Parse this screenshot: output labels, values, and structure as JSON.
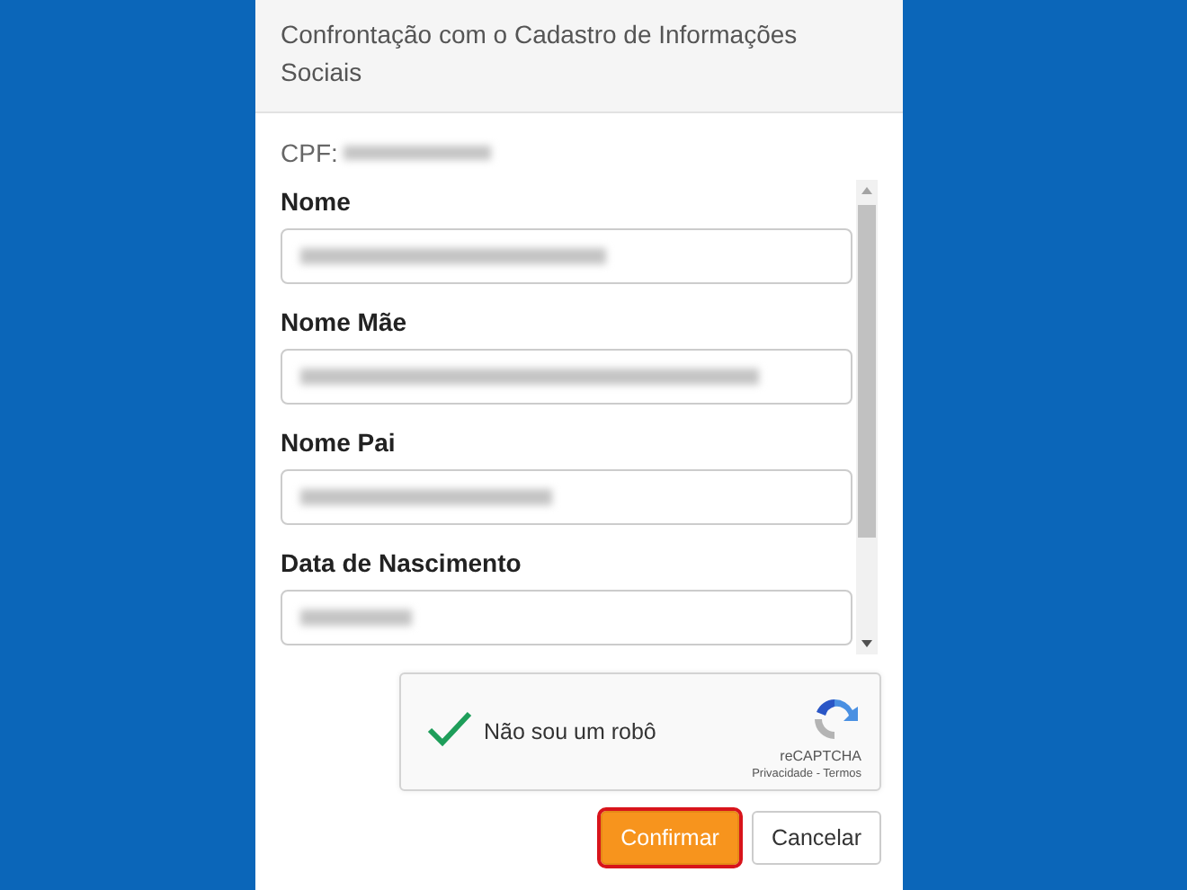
{
  "dialog": {
    "title": "Confrontação com o Cadastro de Informações Sociais",
    "cpf": {
      "label": "CPF:",
      "redacted": true
    },
    "fields": [
      {
        "label": "Nome",
        "redacted": true
      },
      {
        "label": "Nome Mãe",
        "redacted": true
      },
      {
        "label": "Nome Pai",
        "redacted": true
      },
      {
        "label": "Data de Nascimento",
        "redacted": true
      }
    ],
    "captcha": {
      "label": "Não sou um robô",
      "checked": true,
      "brand": "reCAPTCHA",
      "links": "Privacidade - Termos"
    },
    "buttons": [
      {
        "label": "Confirmar",
        "kind": "primary",
        "highlighted": true
      },
      {
        "label": "Cancelar",
        "kind": "secondary",
        "highlighted": false
      }
    ]
  }
}
